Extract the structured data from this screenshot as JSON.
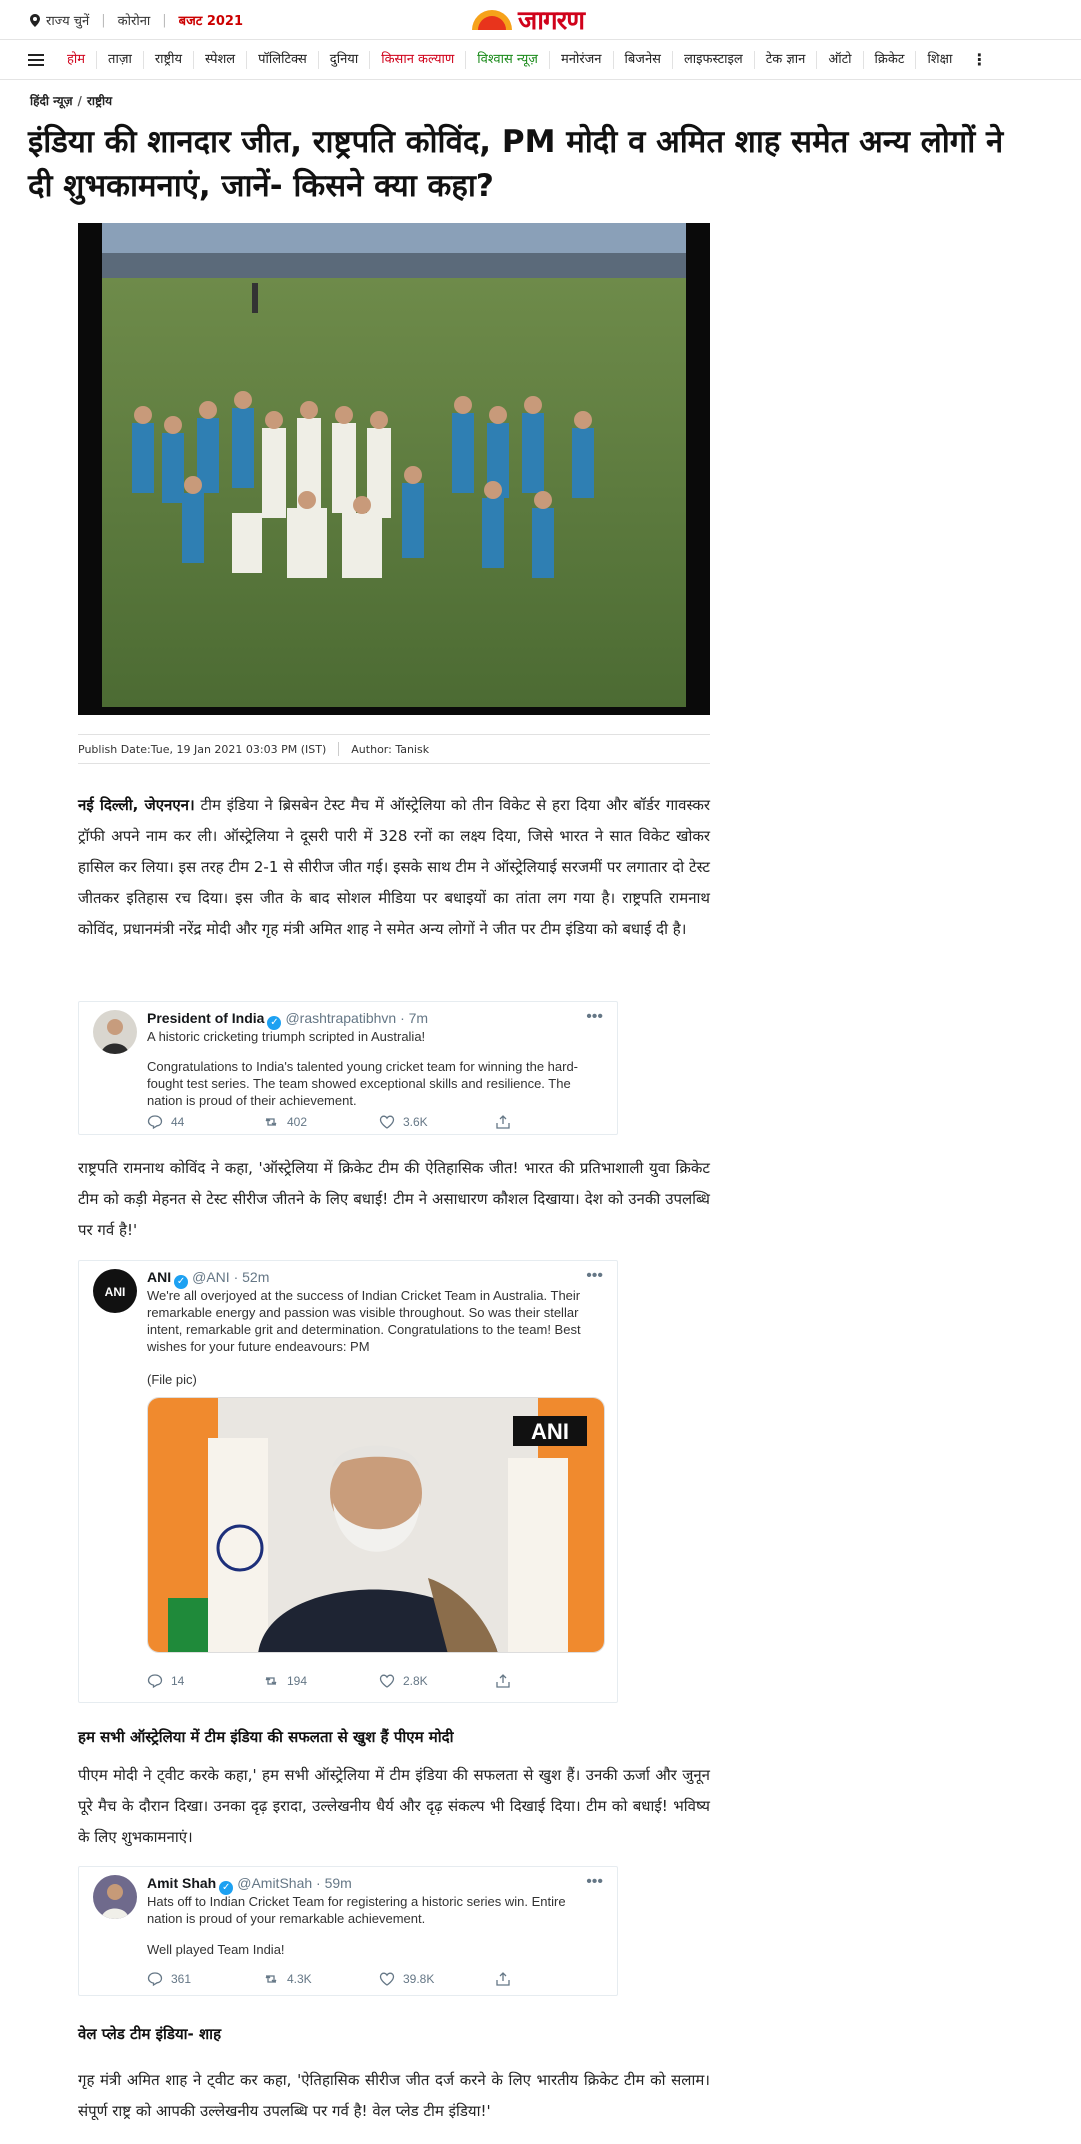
{
  "topbar": {
    "location_label": "राज्य चुनें",
    "link_corona": "कोरोना",
    "link_budget": "बजट 2021",
    "logo_text": "जागरण"
  },
  "nav": {
    "items": [
      "होम",
      "ताज़ा",
      "राष्ट्रीय",
      "स्पेशल",
      "पॉलिटिक्स",
      "दुनिया",
      "किसान कल्याण",
      "विश्वास न्यूज़",
      "मनोरंजन",
      "बिजनेस",
      "लाइफस्टाइल",
      "टेक ज्ञान",
      "ऑटो",
      "क्रिकेट",
      "शिक्षा"
    ]
  },
  "breadcrumb": {
    "home": "हिंदी न्यूज़",
    "section": "राष्ट्रीय"
  },
  "article": {
    "title": "इंडिया की शानदार जीत, राष्ट्रपति कोविंद, PM मोदी व अमित शाह समेत अन्य लोगों ने दी शुभकामनाएं, जानें- किसने क्या कहा?",
    "publish_date": "Publish Date:Tue, 19 Jan 2021 03:03 PM (IST)",
    "author": "Author: Tanisk",
    "para1_lead": "नई दिल्ली, जेएनएन।",
    "para1": " टीम इंडिया ने ब्रिसबेन टेस्ट मैच में ऑस्ट्रेलिया को तीन विकेट से हरा दिया और बॉर्डर गावस्कर ट्रॉफी अपने नाम कर ली। ऑस्ट्रेलिया ने दूसरी पारी में 328 रनों का लक्ष्य दिया, जिसे भारत ने सात विकेट खोकर हासिल कर लिया। इस तरह टीम 2-1 से सीरीज जीत गई। इसके साथ टीम ने ऑस्ट्रेलियाई सरजमीं पर लगातार दो टेस्ट जीतकर इतिहास रच दिया। इस जीत के बाद सोशल मीडिया पर बधाइयों का तांता लग गया है। राष्ट्रपति रामनाथ कोविंद, प्रधानमंत्री नरेंद्र मोदी और गृह मंत्री अमित शाह ने समेत अन्य लोगों ने जीत पर टीम इंडिया को बधाई दी है।",
    "para2": "राष्ट्रपति रामनाथ कोविंद ने कहा, 'ऑस्ट्रेलिया में क्रिकेट टीम की ऐतिहासिक जीत! भारत की प्रतिभाशाली युवा क्रिकेट टीम को कड़ी मेहनत से टेस्ट सीरीज जीतने के लिए बधाई! टीम ने असाधारण कौशल दिखाया। देश को उनकी उपलब्धि पर गर्व है!'",
    "subhead1": "हम सभी ऑस्ट्रेलिया में टीम इंडिया की सफलता से खुश हैं पीएम मोदी",
    "para3": "पीएम मोदी ने ट्वीट करके कहा,' हम सभी ऑस्ट्रेलिया में टीम इंडिया की सफलता से खुश हैं। उनकी ऊर्जा और जुनून पूरे मैच के दौरान दिखा। उनका दृढ़ इरादा, उल्लेखनीय धैर्य और दृढ़ संकल्प भी दिखाई दिया। टीम को बधाई! भविष्य के लिए शुभकामनाएं।",
    "subhead2": "वेल प्लेड टीम इंडिया- शाह",
    "para4": "गृह मंत्री अमित शाह ने ट्वीट कर कहा, 'ऐतिहासिक सीरीज जीत दर्ज करने के लिए भारतीय क्रिकेट टीम को सलाम। संपूर्ण राष्ट्र को आपकी उल्लेखनीय उपलब्धि पर गर्व है! वेल प्लेड टीम इंडिया!'"
  },
  "tweets": [
    {
      "name": "President of India",
      "handle": "@rashtrapatibhvn · 7m",
      "line1": "A historic cricketing triumph scripted in Australia!",
      "line2": "Congratulations to India's talented young cricket team for winning the hard-fought test series. The team showed exceptional skills and resilience. The nation is proud of their achievement.",
      "replies": "44",
      "retweets": "402",
      "likes": "3.6K"
    },
    {
      "name": "ANI",
      "handle": "@ANI · 52m",
      "line1": "We're all overjoyed at the success of Indian Cricket Team in Australia. Their remarkable energy and passion was visible throughout. So was their stellar intent, remarkable grit and determination. Congratulations to the team! Best wishes for your future endeavours: PM",
      "line2": "(File pic)",
      "media_watermark": "ANI",
      "replies": "14",
      "retweets": "194",
      "likes": "2.8K"
    },
    {
      "name": "Amit Shah",
      "handle": "@AmitShah · 59m",
      "line1": "Hats off to Indian Cricket Team for registering a historic series win. Entire nation is proud of your remarkable achievement.",
      "line2": "Well played Team India!",
      "replies": "361",
      "retweets": "4.3K",
      "likes": "39.8K"
    }
  ],
  "colors": {
    "brand_red": "#d0021b",
    "twitter_blue": "#1da1f2",
    "green_link": "#1a8a1a"
  }
}
